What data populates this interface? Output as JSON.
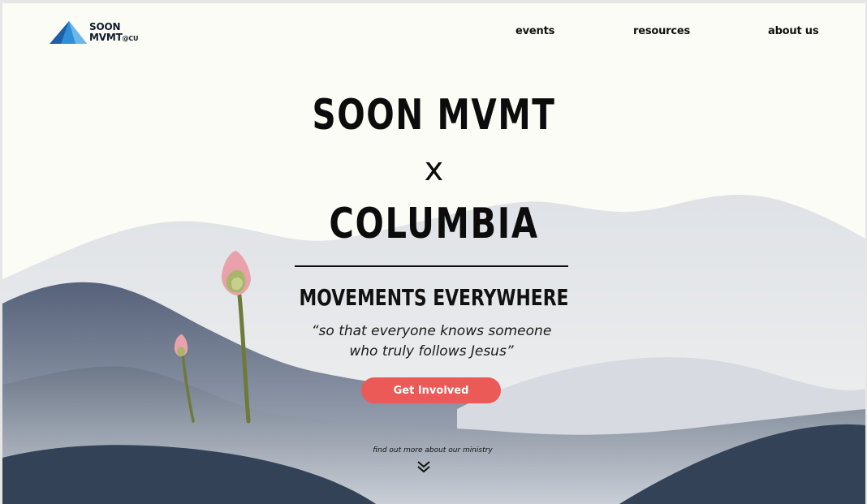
{
  "header": {
    "logo": {
      "line1": "SOON",
      "line2": "MVMT",
      "suffix": "@CU"
    },
    "nav": [
      {
        "label": "events"
      },
      {
        "label": "resources"
      },
      {
        "label": "about us"
      }
    ]
  },
  "hero": {
    "title_line1": "SOON MVMT",
    "title_x": "x",
    "title_line2": "COLUMBIA",
    "tagline": "MOVEMENTS EVERYWHERE",
    "quote_line1": "“so that everyone knows someone",
    "quote_line2": "who truly follows Jesus”",
    "cta_label": "Get Involved",
    "scroll_hint": "find out more about our ministry"
  },
  "icons": {
    "logo_mark": "mountain-logo-icon",
    "scroll": "double-chevron-down-icon"
  },
  "colors": {
    "background": "#fbfcf5",
    "accent": "#ec5a57",
    "logo_blue": "#2f6fb0",
    "mountain_dark": "#344257",
    "mountain_mid": "#7a8597",
    "mountain_light": "#e2e5e9"
  }
}
